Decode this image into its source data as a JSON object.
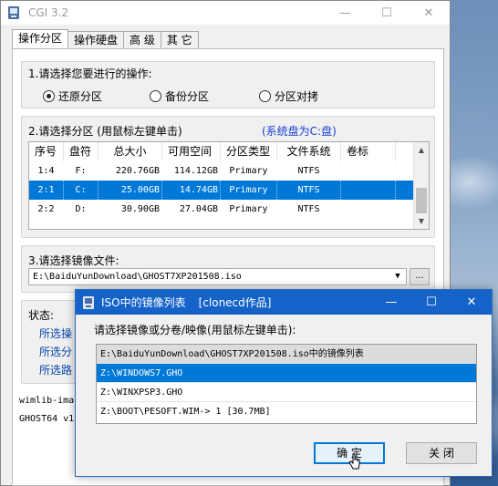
{
  "main_window": {
    "title": "CGI 3.2",
    "controls": {
      "minimize": "—",
      "maximize": "☐",
      "close": "✕"
    }
  },
  "tabs": [
    {
      "label": "操作分区",
      "active": true
    },
    {
      "label": "操作硬盘",
      "active": false
    },
    {
      "label": "高 级",
      "active": false
    },
    {
      "label": "其 它",
      "active": false
    }
  ],
  "section1": {
    "title": "1.请选择您要进行的操作:",
    "options": [
      {
        "label": "还原分区",
        "selected": true
      },
      {
        "label": "备份分区",
        "selected": false
      },
      {
        "label": "分区对拷",
        "selected": false
      }
    ]
  },
  "section2": {
    "title": "2.请选择分区 (用鼠标左键单击)",
    "system_note": "(系统盘为C:盘)",
    "columns": [
      "序号",
      "盘符",
      "总大小",
      "可用空间",
      "分区类型",
      "文件系统",
      "卷标"
    ],
    "rows": [
      {
        "id": "1:4",
        "drive": "F:",
        "total": "220.76GB",
        "free": "114.12GB",
        "type": "Primary",
        "fs": "NTFS",
        "label": "",
        "selected": false
      },
      {
        "id": "2:1",
        "drive": "C:",
        "total": "25.00GB",
        "free": "14.74GB",
        "type": "Primary",
        "fs": "NTFS",
        "label": "",
        "selected": true
      },
      {
        "id": "2:2",
        "drive": "D:",
        "total": "30.90GB",
        "free": "27.04GB",
        "type": "Primary",
        "fs": "NTFS",
        "label": "",
        "selected": false
      }
    ]
  },
  "section3": {
    "title": "3.请选择镜像文件:",
    "path_value": "E:\\BaiduYunDownload\\GHOST7XP201508.iso",
    "browse_label": "..."
  },
  "status": {
    "title": "状态:",
    "lines": [
      "所选操",
      "所选分",
      "所选路"
    ]
  },
  "footer_lines": [
    "wimlib-imag",
    "GHOST64 v1"
  ],
  "dialog": {
    "title": "ISO中的镜像列表",
    "subtitle": "[clonecd作品]",
    "controls": {
      "minimize": "—",
      "maximize": "☐",
      "close": "✕"
    },
    "prompt": "请选择镜像或分卷/映像(用鼠标左键单击):",
    "items": [
      {
        "text": "E:\\BaiduYunDownload\\GHOST7XP201508.iso中的镜像列表",
        "kind": "head"
      },
      {
        "text": "Z:\\WINDOWS7.GHO",
        "kind": "sel"
      },
      {
        "text": "Z:\\WINXPSP3.GHO",
        "kind": "normal"
      },
      {
        "text": "Z:\\BOOT\\PESOFT.WIM-> 1    [30.7MB]",
        "kind": "normal"
      }
    ],
    "ok_label": "确 定",
    "close_label": "关 闭"
  },
  "colors": {
    "selection": "#0078d7",
    "dialog_title": "#1563c9",
    "link": "#0645ad",
    "system_note": "#1a3fd6"
  }
}
